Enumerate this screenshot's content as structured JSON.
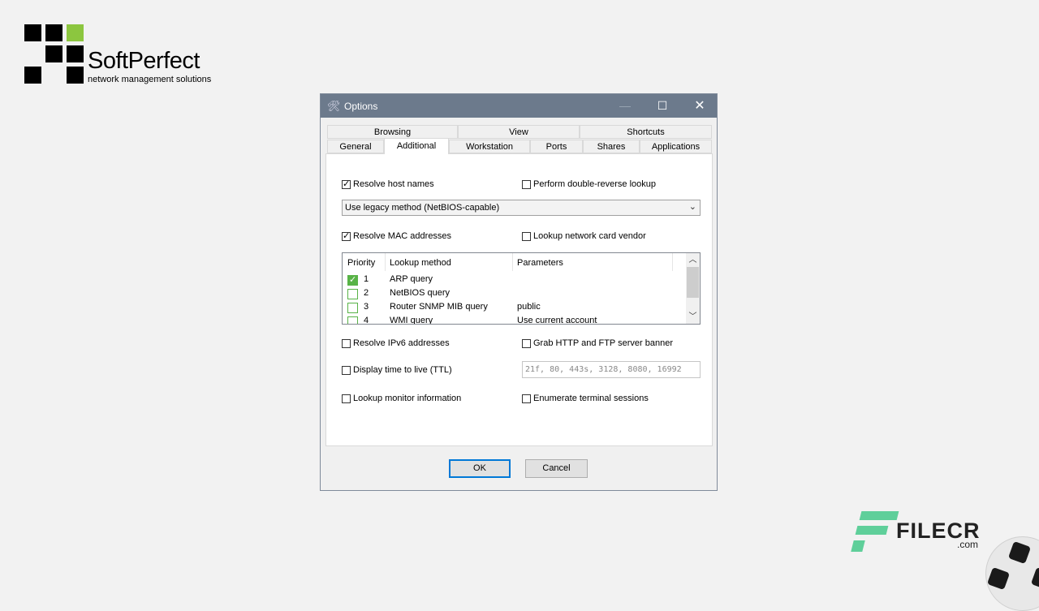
{
  "logo": {
    "name": "SoftPerfect",
    "tagline": "network management solutions"
  },
  "dialog": {
    "title": "Options",
    "title_icon": "tools-icon",
    "controls": {
      "minimize": "—",
      "maximize": "☐",
      "close": "✕"
    }
  },
  "tabs": {
    "row1": [
      "Browsing",
      "View",
      "Shortcuts"
    ],
    "row2": [
      "General",
      "Additional",
      "Workstation",
      "Ports",
      "Shares",
      "Applications"
    ],
    "active": "Additional"
  },
  "options": {
    "resolve_host_names": {
      "label": "Resolve host names",
      "checked": true
    },
    "double_reverse": {
      "label": "Perform double-reverse lookup",
      "checked": false
    },
    "method_select": {
      "value": "Use legacy method (NetBIOS-capable)"
    },
    "resolve_mac": {
      "label": "Resolve MAC addresses",
      "checked": true
    },
    "lookup_vendor": {
      "label": "Lookup network card vendor",
      "checked": false
    },
    "resolve_ipv6": {
      "label": "Resolve IPv6 addresses",
      "checked": false
    },
    "grab_banner": {
      "label": "Grab HTTP and FTP server banner",
      "checked": false
    },
    "display_ttl": {
      "label": "Display time to live (TTL)",
      "checked": false
    },
    "ports_field": {
      "value": "21f, 80, 443s, 3128, 8080, 16992"
    },
    "lookup_monitor": {
      "label": "Lookup monitor information",
      "checked": false
    },
    "enumerate_sessions": {
      "label": "Enumerate terminal sessions",
      "checked": false
    }
  },
  "lookup_table": {
    "headers": [
      "Priority",
      "Lookup method",
      "Parameters"
    ],
    "rows": [
      {
        "priority": "1",
        "method": "ARP query",
        "parameters": "",
        "checked": true
      },
      {
        "priority": "2",
        "method": "NetBIOS query",
        "parameters": "",
        "checked": false
      },
      {
        "priority": "3",
        "method": "Router SNMP MIB query",
        "parameters": "public",
        "checked": false
      },
      {
        "priority": "4",
        "method": "WMI query",
        "parameters": "Use current account",
        "checked": false
      }
    ]
  },
  "buttons": {
    "ok": "OK",
    "cancel": "Cancel"
  },
  "watermark": {
    "text": "FILECR",
    "domain": ".com",
    "accent": "#5fcf9a"
  },
  "colors": {
    "titlebar": "#6c7a8c",
    "check_green": "#58b347",
    "focus_blue": "#0078d7"
  }
}
